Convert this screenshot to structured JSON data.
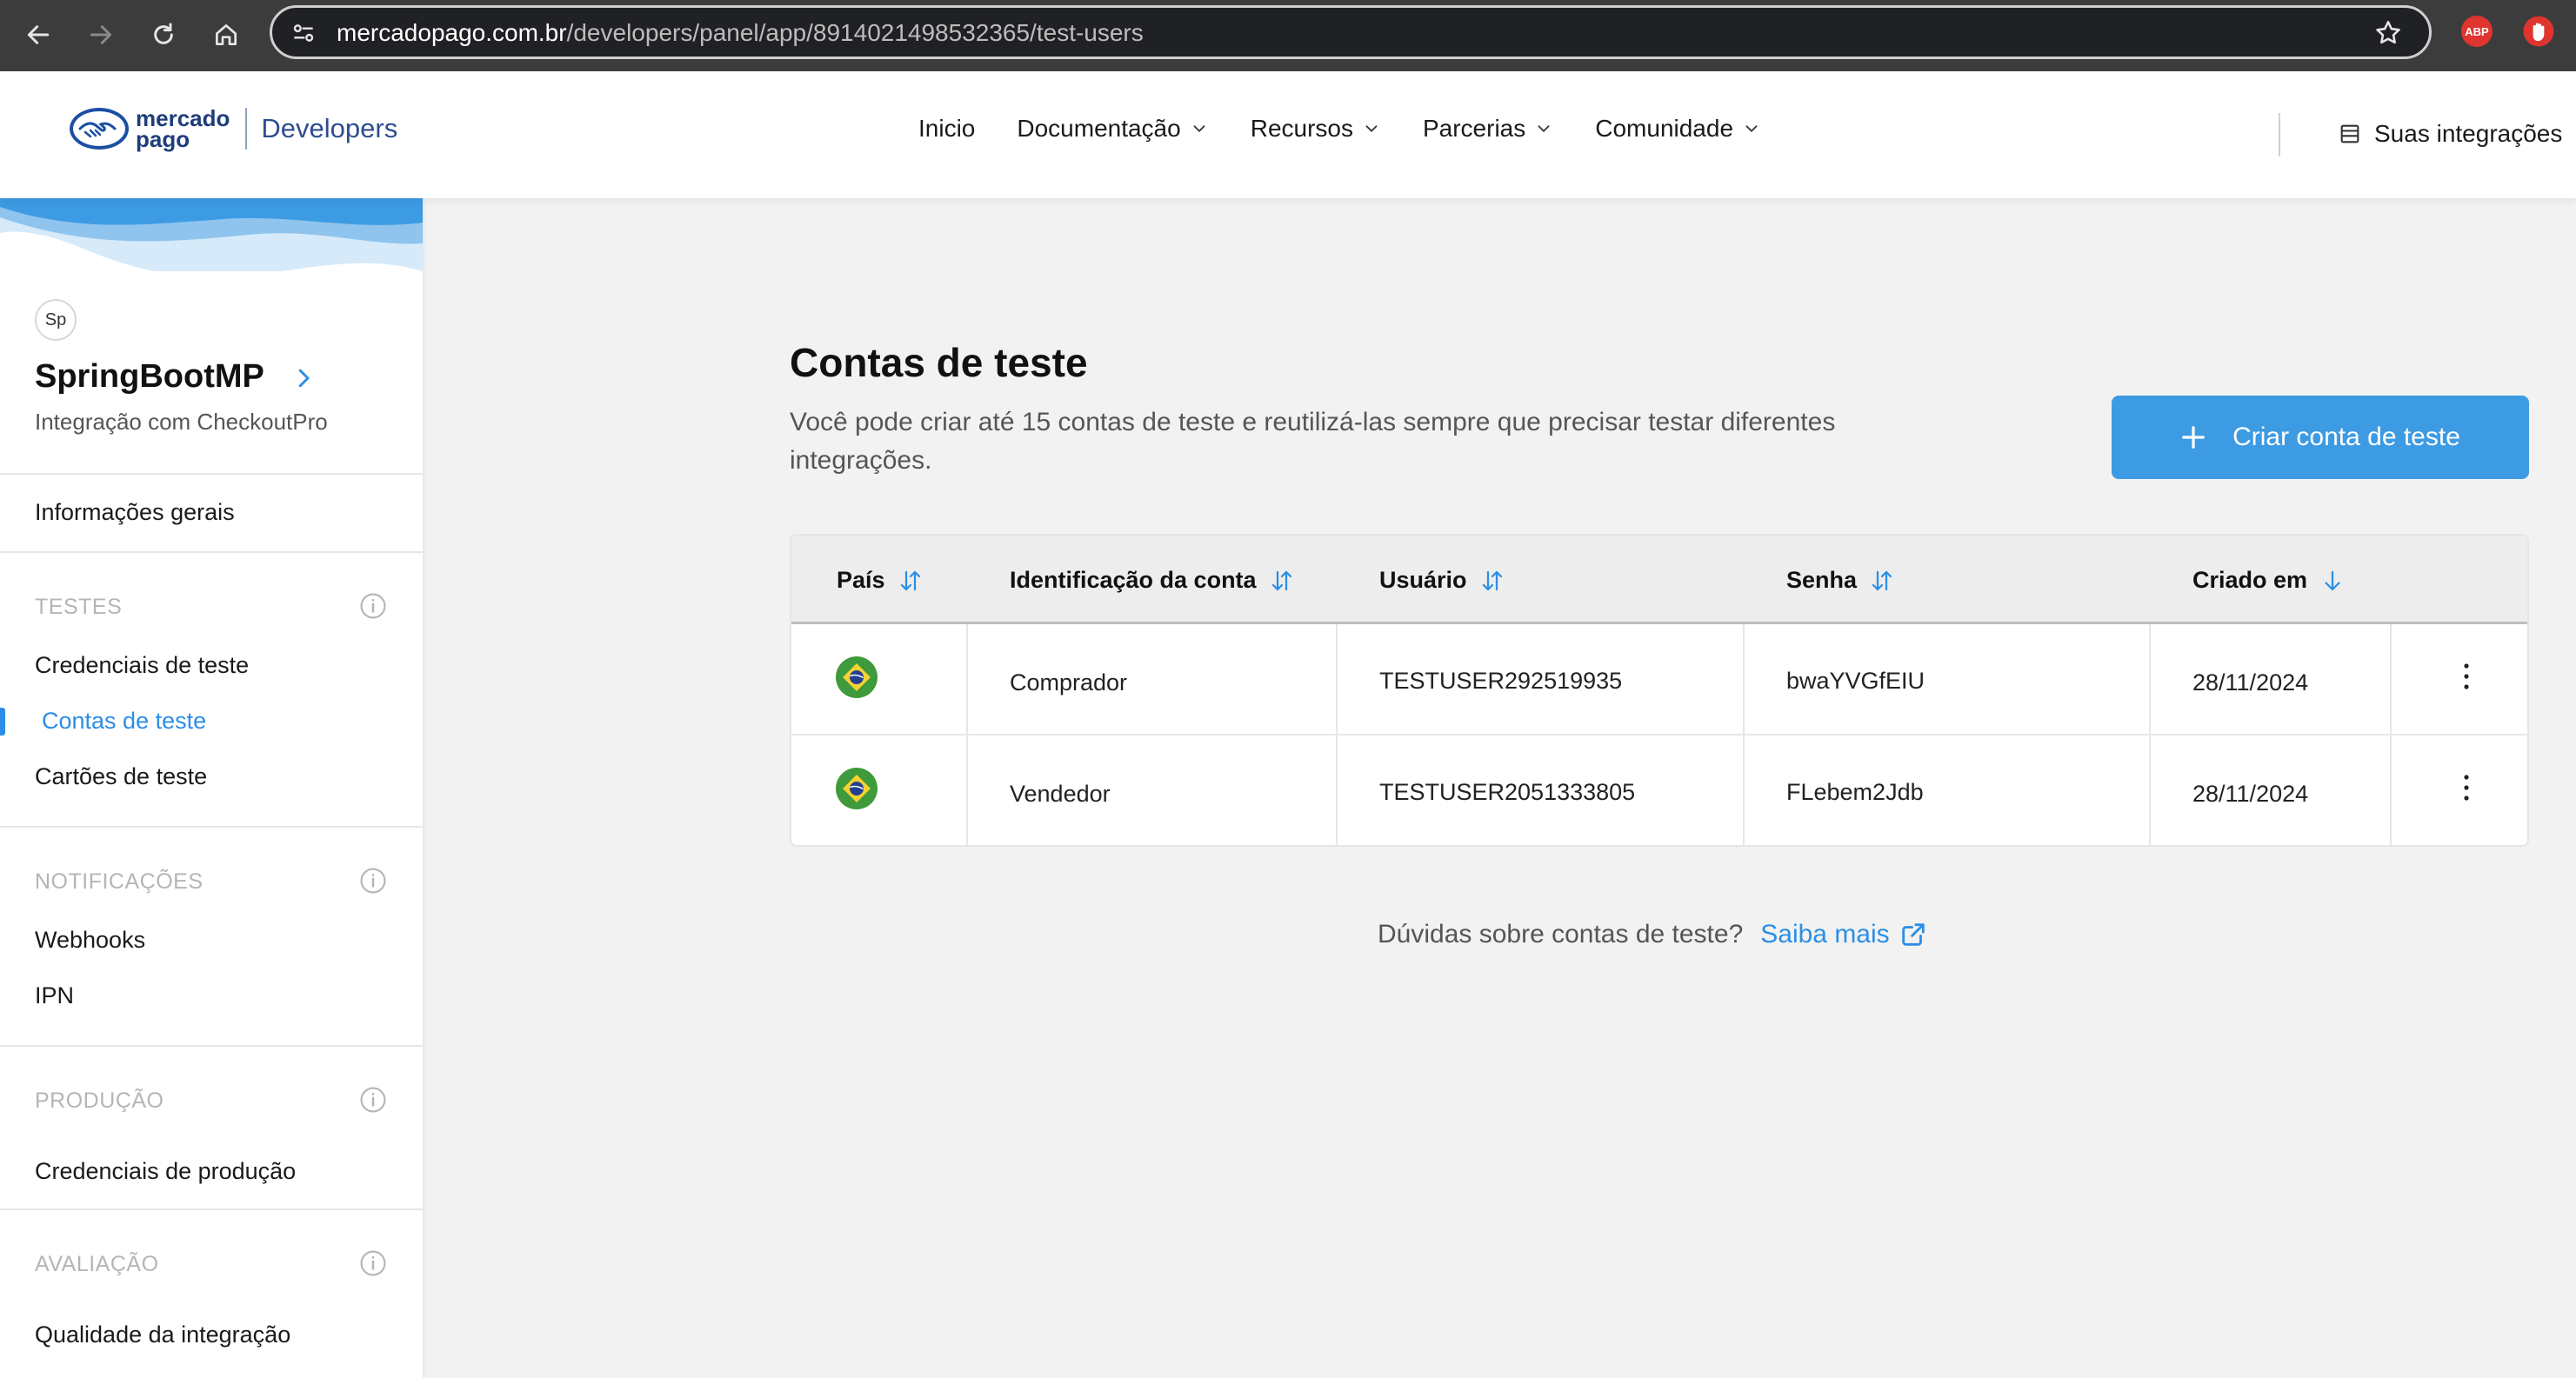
{
  "browser": {
    "url_host": "mercadopago.com.br",
    "url_path": "/developers/panel/app/8914021498532365/test-users",
    "extension_abp": "ABP"
  },
  "header": {
    "logo_line1": "mercado",
    "logo_line2": "pago",
    "logo_developers": "Developers",
    "nav": [
      "Inicio",
      "Documentação",
      "Recursos",
      "Parcerias",
      "Comunidade"
    ],
    "integrations": "Suas integrações"
  },
  "sidebar": {
    "avatar": "Sp",
    "app_name": "SpringBootMP",
    "app_sub": "Integração com CheckoutPro",
    "general": "Informações gerais",
    "sections": {
      "tests": "TESTES",
      "notifications": "NOTIFICAÇÕES",
      "production": "PRODUÇÃO",
      "evaluation": "AVALIAÇÃO"
    },
    "links": {
      "test_credentials": "Credenciais de teste",
      "test_accounts": "Contas de teste",
      "test_cards": "Cartões de teste",
      "webhooks": "Webhooks",
      "ipn": "IPN",
      "production_credentials": "Credenciais de produção",
      "integration_quality": "Qualidade da integração"
    }
  },
  "main": {
    "title": "Contas de teste",
    "description": "Você pode criar até 15 contas de teste e reutilizá-las sempre que precisar testar diferentes integrações.",
    "create_button": "Criar conta de teste",
    "table": {
      "headers": [
        "País",
        "Identificação da conta",
        "Usuário",
        "Senha",
        "Criado em"
      ],
      "rows": [
        {
          "country": "Brasil",
          "account": "Comprador",
          "user": "TESTUSER292519935",
          "password": "bwaYVGfEIU",
          "created": "28/11/2024"
        },
        {
          "country": "Brasil",
          "account": "Vendedor",
          "user": "TESTUSER2051333805",
          "password": "FLebem2Jdb",
          "created": "28/11/2024"
        }
      ]
    },
    "help_text": "Dúvidas sobre contas de teste?",
    "help_link": "Saiba mais"
  },
  "colors": {
    "accent": "#2b8ee6",
    "button": "#3d9be3",
    "browser_bar": "#3c3c3c"
  },
  "icons": [
    "back-arrow-icon",
    "forward-arrow-icon",
    "reload-icon",
    "home-icon",
    "site-settings-icon",
    "bookmark-star-icon",
    "chevron-down-icon",
    "list-icon",
    "chevron-right-icon",
    "info-icon",
    "sort-icon",
    "sort-down-icon",
    "plus-icon",
    "brazil-flag-icon",
    "kebab-menu-icon",
    "external-link-icon"
  ]
}
